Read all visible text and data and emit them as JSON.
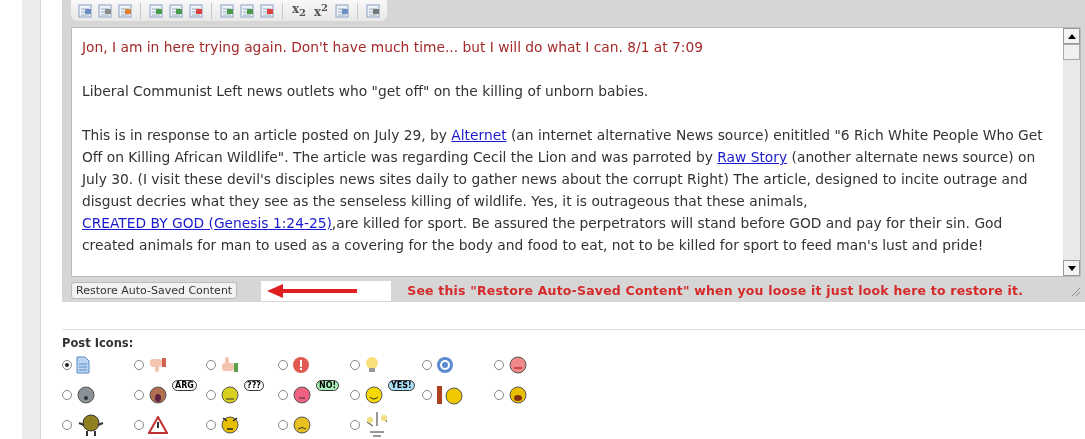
{
  "toolbar": [
    {
      "kind": "table"
    },
    {
      "kind": "table-gear"
    },
    {
      "kind": "table-remove"
    },
    {
      "kind": "sep"
    },
    {
      "kind": "col-left"
    },
    {
      "kind": "col-left2"
    },
    {
      "kind": "col-right"
    },
    {
      "kind": "sep"
    },
    {
      "kind": "row-down"
    },
    {
      "kind": "row-down2"
    },
    {
      "kind": "row-up"
    },
    {
      "kind": "sep"
    },
    {
      "kind": "glyph",
      "text": "x$_{2}$"
    },
    {
      "kind": "glyph",
      "text": "x$^{2}$"
    },
    {
      "kind": "lines"
    },
    {
      "kind": "sep"
    },
    {
      "kind": "page"
    }
  ],
  "editor": {
    "paragraphs": [
      {
        "color": "#a52a2a",
        "segments": [
          {
            "kind": "text",
            "text": "Jon, I am in here trying again. Don't have much time... but I will do what I can. 8/1 at 7:09"
          }
        ]
      },
      {
        "segments": [
          {
            "kind": "text",
            "text": "Liberal Communist Left news outlets who \"get off\" on the killing of unborn babies."
          }
        ]
      },
      {
        "segments": [
          {
            "kind": "text",
            "text": "This is in response to an article posted on July 29, by "
          },
          {
            "kind": "link",
            "text": "Alternet"
          },
          {
            "kind": "text",
            "text": " (an internet alternative News source) enititled \"6 Rich White People Who Get Off on Killing African Wildlife\". The article was regarding Cecil the Lion and was parroted by "
          },
          {
            "kind": "link",
            "text": "Raw Story"
          },
          {
            "kind": "text",
            "text": " (another alternate news source) on July 30. (I visit these devil's disciples news sites daily to gather news about the corrupt Right) The article, designed to incite outrage and disgust decries what they see as the senseless killing of wildlife. Yes, it is outrageous that these animals, "
          },
          {
            "kind": "link",
            "text": "CREATED BY GOD (Genesis 1:24-25)"
          },
          {
            "kind": "text",
            "text": ",are killed for sport. Be assured the perpetrators will stand before GOD and pay for their sin. God created animals for man to used as a covering for the body and food to eat, not to be killed for sport to feed man's lust and pride!"
          }
        ]
      }
    ],
    "restore_button": "Restore Auto-Saved Content",
    "annotation": "See this \"Restore Auto-Saved Content\" when you loose it just look here to restore it."
  },
  "post_icons": {
    "label": "Post Icons:",
    "options": [
      {
        "selected": true
      },
      {
        "selected": false
      },
      {
        "selected": false
      },
      {
        "selected": false
      },
      {
        "selected": false
      },
      {
        "selected": false
      },
      {
        "selected": false
      },
      {
        "selected": false
      },
      {
        "bubble": "ARG",
        "selected": false
      },
      {
        "bubble": "???",
        "selected": false
      },
      {
        "bubble": "NO!",
        "selected": false
      },
      {
        "bubble": "YES!",
        "selected": false
      },
      {
        "selected": false
      },
      {
        "selected": false
      },
      {
        "selected": false
      },
      {
        "selected": false
      },
      {
        "selected": false
      },
      {
        "selected": false
      },
      {
        "selected": false
      }
    ]
  }
}
